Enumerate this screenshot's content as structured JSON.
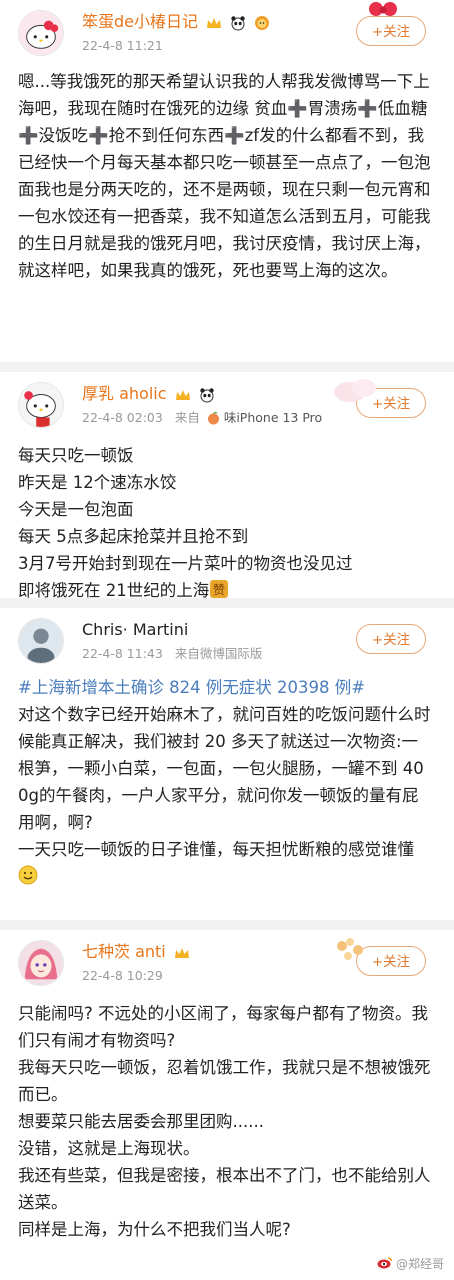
{
  "posts": [
    {
      "user": {
        "name": "笨蛋de小椿日记",
        "time": "22-4-8 11:21",
        "source": ""
      },
      "follow_label": "+关注",
      "body": [
        "嗯...等我饿死的那天希望认识我的人帮我发微博骂一下上海吧，我现在随时在饿死的边缘 贫血➕胃溃疡➕低血糖➕没饭吃➕抢不到任何东西➕zf发的什么都看不到，我已经快一个月每天基本都只吃一顿甚至一点点了，一包泡面我也是分两天吃的，还不是两顿，现在只剩一包元宵和一包水饺还有一把香菜，我不知道怎么活到五月，可能我的生日月就是我的饿死月吧，我讨厌疫情，我讨厌上海，就这样吧，如果我真的饿死，死也要骂上海的这次。"
      ]
    },
    {
      "user": {
        "name": "厚乳 aholic",
        "time": "22-4-8 02:03",
        "source_prefix": "来自",
        "source": "味iPhone 13 Pro"
      },
      "follow_label": "+关注",
      "body": [
        "每天只吃一顿饭",
        "昨天是 12个速冻水饺",
        "今天是一包泡面",
        "每天 5点多起床抢菜并且抢不到",
        "3月7号开始封到现在一片菜叶的物资也没见过",
        "即将饿死在 21世纪的上海"
      ]
    },
    {
      "user": {
        "name": "Chris· Martini",
        "time": "22-4-8 11:43",
        "source": "来自微博国际版"
      },
      "follow_label": "+关注",
      "hashtag": "#上海新增本土确诊 824 例无症状 20398 例#",
      "body": [
        "对这个数字已经开始麻木了，就问百姓的吃饭问题什么时候能真正解决，我们被封 20 多天了就送过一次物资:一根笋，一颗小白菜，一包面，一包火腿肠，一罐不到 400g的午餐肉，一户人家平分，就问你发一顿饭的量有屁用啊，啊?",
        "一天只吃一顿饭的日子谁懂，每天担忧断粮的感觉谁懂"
      ]
    },
    {
      "user": {
        "name": "七种茨 anti",
        "time": "22-4-8 10:29",
        "source": ""
      },
      "follow_label": "+关注",
      "body": [
        "只能闹吗? 不远处的小区闹了，每家每户都有了物资。我们只有闹才有物资吗?",
        "我每天只吃一顿饭，忍着饥饿工作，我就只是不想被饿死而已。",
        "想要菜只能去居委会那里团购......",
        "没错，这就是上海现状。",
        "我还有些菜，但我是密接，根本出不了门，也不能给别人送菜。",
        "同样是上海，为什么不把我们当人呢?"
      ]
    }
  ],
  "watermark": "@郑经哥",
  "colors": {
    "name": "#e8751a",
    "hashtag": "#4a7dbd",
    "follow": "#e07a2e",
    "meta": "#9a9a9a"
  },
  "icons": [
    "hello-kitty-avatar",
    "crown-badge",
    "panda-badge",
    "lion-badge",
    "plus-icon",
    "laugh-cry-emoji",
    "smile-emoji",
    "weibo-logo"
  ]
}
